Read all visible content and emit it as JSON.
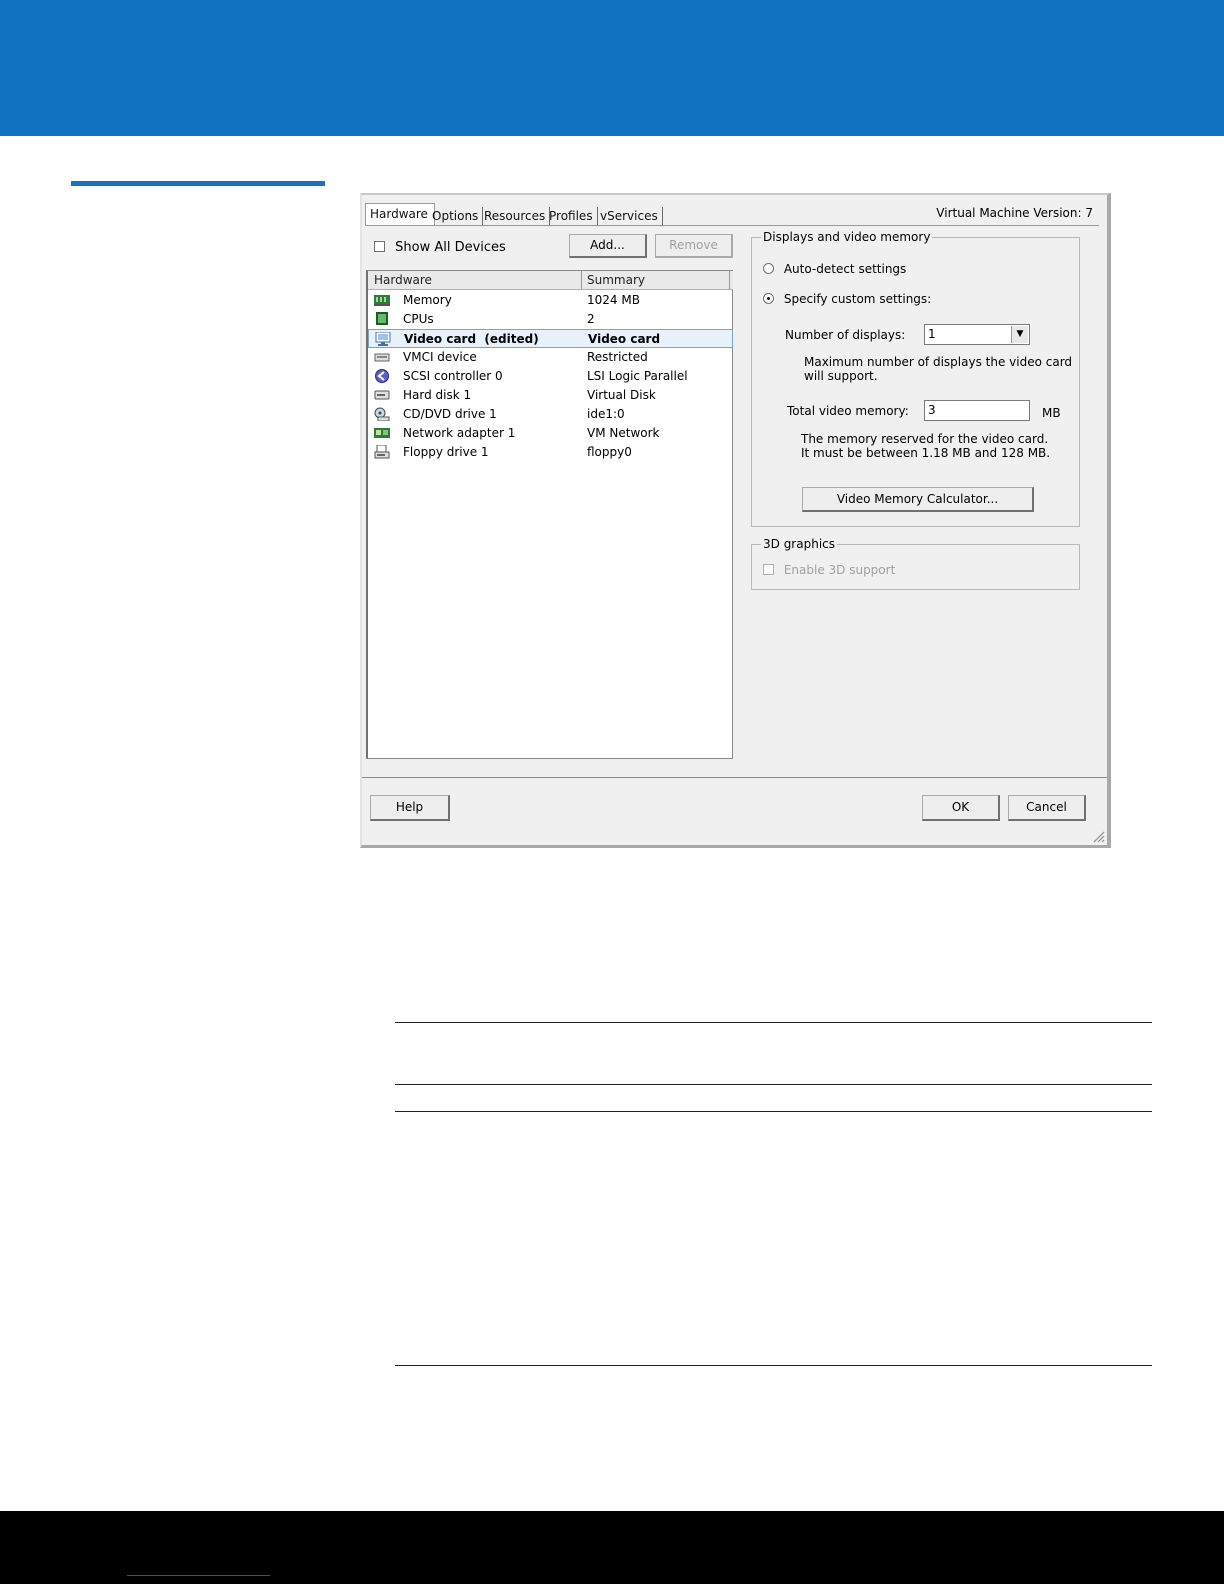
{
  "dialog": {
    "tabs": [
      "Hardware",
      "Options",
      "Resources",
      "Profiles",
      "vServices"
    ],
    "vm_version": "Virtual Machine Version: 7",
    "show_all_devices": "Show All Devices",
    "add_button": "Add...",
    "remove_button": "Remove",
    "hardware_table": {
      "columns": [
        "Hardware",
        "Summary"
      ],
      "rows": [
        {
          "name": "Memory",
          "summary": "1024 MB",
          "icon": "memory-icon"
        },
        {
          "name": "CPUs",
          "summary": "2",
          "icon": "cpu-icon"
        },
        {
          "name": "Video card  (edited)",
          "summary": "Video card",
          "icon": "monitor-icon",
          "selected": true
        },
        {
          "name": "VMCI device",
          "summary": "Restricted",
          "icon": "device-icon"
        },
        {
          "name": "SCSI controller 0",
          "summary": "LSI Logic Parallel",
          "icon": "scsi-controller-icon"
        },
        {
          "name": "Hard disk 1",
          "summary": "Virtual Disk",
          "icon": "hard-disk-icon"
        },
        {
          "name": "CD/DVD drive 1",
          "summary": "ide1:0",
          "icon": "cd-drive-icon"
        },
        {
          "name": "Network adapter 1",
          "summary": "VM Network",
          "icon": "network-adapter-icon"
        },
        {
          "name": "Floppy drive 1",
          "summary": "floppy0",
          "icon": "floppy-drive-icon"
        }
      ]
    },
    "displays_group": {
      "title": "Displays and video memory",
      "auto_detect": "Auto-detect settings",
      "custom": "Specify custom settings:",
      "num_displays_label": "Number of displays:",
      "num_displays_value": "1",
      "max_displays_note_1": "Maximum number of displays the video card",
      "max_displays_note_2": "will support.",
      "total_memory_label": "Total video memory:",
      "total_memory_value": "3",
      "total_memory_unit": "MB",
      "memory_note_1": "The memory reserved for the video card.",
      "memory_note_2": "It must be between 1.18 MB and 128 MB.",
      "calculator_button": "Video Memory Calculator..."
    },
    "graphics_group": {
      "title": "3D graphics",
      "enable_3d": "Enable 3D support"
    },
    "help_button": "Help",
    "ok_button": "OK",
    "cancel_button": "Cancel"
  }
}
